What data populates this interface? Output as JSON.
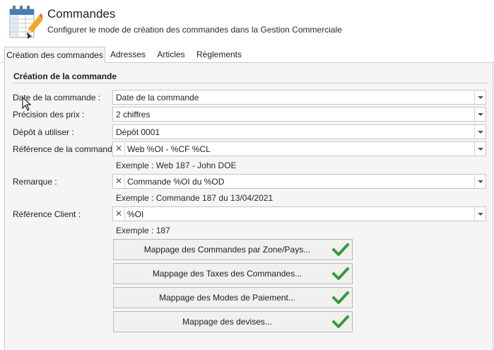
{
  "header": {
    "title": "Commandes",
    "subtitle": "Configurer le mode de création des commandes dans la Gestion Commerciale",
    "icon": "orders-table-pencil-icon"
  },
  "tabs": [
    {
      "label": "Création des commandes",
      "active": true
    },
    {
      "label": "Adresses",
      "active": false
    },
    {
      "label": "Articles",
      "active": false
    },
    {
      "label": "Règlements",
      "active": false
    }
  ],
  "section": {
    "title": "Création de la commande",
    "fields": {
      "date": {
        "label": "Date de la commande :",
        "value": "Date de la commande"
      },
      "precision": {
        "label": "Précision des prix :",
        "value": "2 chiffres"
      },
      "depot": {
        "label": "Dépôt à utiliser :",
        "value": "Dépôt 0001"
      },
      "reference": {
        "label": "Référence de la commande :",
        "value": "Web %OI - %CF %CL",
        "example": "Exemple : Web 187 - John DOE"
      },
      "remarque": {
        "label": "Remarque :",
        "value": "Commande %OI du %OD",
        "example": "Exemple : Commande 187 du 13/04/2021"
      },
      "ref_client": {
        "label": "Référence Client :",
        "value": "%OI",
        "example": "Exemple : 187"
      }
    }
  },
  "mapping_buttons": [
    {
      "label": "Mappage des Commandes par Zone/Pays...",
      "status": "check-icon"
    },
    {
      "label": "Mappage des Taxes des Commandes...",
      "status": "check-icon"
    },
    {
      "label": "Mappage des Modes de Paiement...",
      "status": "check-icon"
    },
    {
      "label": "Mappage des devises...",
      "status": "check-icon"
    }
  ],
  "colors": {
    "check_green": "#3a9a3a",
    "panel_bg": "#f5f5f5",
    "border": "#c9c9c9"
  }
}
